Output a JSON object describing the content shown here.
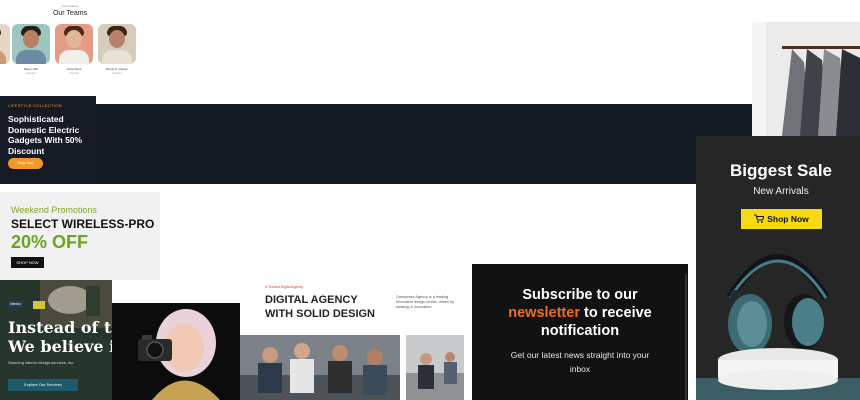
{
  "team_card": {
    "subtitle": "Our Leaders",
    "title": "Our Teams",
    "members": [
      {
        "name": "Rayan Tan",
        "role": "Founder"
      },
      {
        "name": "Anna Sons",
        "role": "Founder"
      },
      {
        "name": "Brody K. Hunter",
        "role": "Founder"
      }
    ]
  },
  "lifestyle_banner": {
    "tag": "LIFESTYLE COLLECTION",
    "title": "Sophisticated Domestic Electric Gadgets With 50% Discount",
    "button": "Shop Now",
    "accent": "#f19a2a"
  },
  "wireless_banner": {
    "tag": "Weekend Promotions",
    "title": "SELECT WIRELESS-PRO",
    "offer": "20% OFF",
    "button": "SHOP NOW",
    "accent": "#6aa521"
  },
  "interior_banner": {
    "tag": "Interior",
    "headline_1": "Instead of th",
    "headline_2": "We believe i",
    "body": "Stunning interior design services, wo",
    "button": "Explore Our Services"
  },
  "agency_banner": {
    "tag": "A Trusted Digital Agency",
    "headline_1": "DIGITAL AGENCY",
    "headline_2": "WITH SOLID DESIGN",
    "body": "Omnipress Agency is a leading innovative design studio, driven by strategy & innovation."
  },
  "newsletter_banner": {
    "line_1": "Subscribe to our",
    "highlight": "newsletter",
    "line_2_rest": " to receive",
    "line_3": "notification",
    "body": "Get our latest news straight into your inbox",
    "accent": "#f26b1d"
  },
  "sale_banner": {
    "title": "Biggest Sale",
    "subtitle": "New Arrivals",
    "button": "Shop Now",
    "button_icon": "cart-icon",
    "accent": "#f7da12"
  }
}
